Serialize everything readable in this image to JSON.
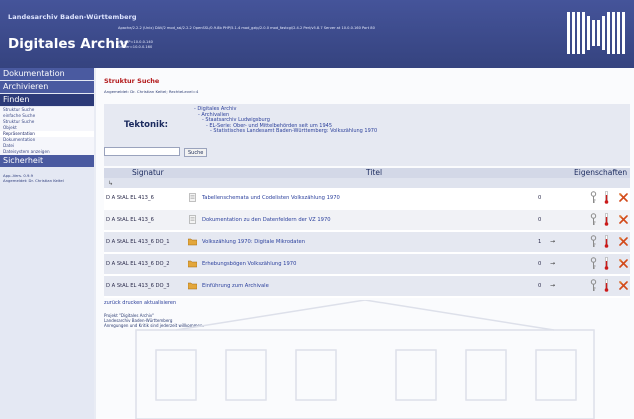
{
  "header": {
    "org": "Landesarchiv Baden-Württemberg",
    "app": "Digitales Archiv",
    "server_line": "Apache/2.2.2 (Unix) DAV/2 mod_ssl/2.2.2 OpenSSL/0.9.8b PHP/5.1.4 mod_gzip/2.0.0 mod_fastcgi/2.4.2 Perl/v5.8.7 Server at 10.0.0.160 Port 80",
    "version_lines": [
      "your IP=10.0.0.140",
      "Server=10.0.0.160"
    ]
  },
  "sidebar": {
    "sections": [
      {
        "label": "Dokumentation"
      },
      {
        "label": "Archivieren"
      },
      {
        "label": "Finden"
      },
      {
        "label": "Sicherheit"
      }
    ],
    "finden_items": [
      {
        "label": "Struktur Suche",
        "current": false
      },
      {
        "label": "einfache Suche",
        "current": false
      },
      {
        "label": "Struktur Suche",
        "current": false
      },
      {
        "label": "Objekt",
        "current": false
      },
      {
        "label": "Repräsentation",
        "current": true
      },
      {
        "label": "Dokumentation",
        "current": false
      },
      {
        "label": "Datei",
        "current": false
      },
      {
        "label": "Dateisystem anzeigen",
        "current": false
      }
    ],
    "app_version": "App.-Vers. 0.9.9",
    "logged_in": "Angemeldet: Dr. Christian Keitel"
  },
  "main": {
    "title": "Struktur Suche",
    "login": "Angemeldet: Dr. Christian Keitel; RechteLevel=4",
    "tektonik_label": "Tektonik:",
    "tree": [
      "- Digitales Archiv",
      "- Archivalien",
      "- Staatsarchiv Ludwigsburg",
      "- EL-Serie: Ober- und Mittelbehörden seit um 1945",
      "- Statistisches Landesamt Baden-Württemberg: Volkszählung 1970"
    ],
    "search_value": "",
    "search_button": "Suche",
    "columns": {
      "signatur": "Signatur",
      "titel": "Titel",
      "eigenschaften": "Eigenschaften"
    },
    "rows": [
      {
        "signatur": "D A StAL EL 413_6",
        "title": "Tabellenschemata und Codelisten Volkszählung 1970",
        "count": "0",
        "type": "doc",
        "arrow": false
      },
      {
        "signatur": "D A StAL EL 413_6",
        "title": "Dokumentation zu den Datenfeldern der VZ 1970",
        "count": "0",
        "type": "doc",
        "arrow": false
      },
      {
        "signatur": "D A StAL EL 413_6 DO_1",
        "title": "Volkszählung 1970: Digitale Mikrodaten",
        "count": "1",
        "type": "folder",
        "arrow": true
      },
      {
        "signatur": "D A StAL EL 413_6 DO_2",
        "title": "Erhebungsbögen Volkszählung 1970",
        "count": "0",
        "type": "folder",
        "arrow": true
      },
      {
        "signatur": "D A StAL EL 413_6 DO_3",
        "title": "Einführung zum Archivale",
        "count": "0",
        "type": "folder",
        "arrow": true
      }
    ],
    "footer_links": [
      "zurück",
      "drucken",
      "aktualisieren"
    ],
    "project_info": [
      "Projekt \"Digitales Archiv\"",
      "Landesarchiv Baden-Württemberg",
      "Anregungen und Kritik sind jederzeit willkommen."
    ]
  },
  "colors": {
    "header": "#3b4a8e",
    "nav_active": "#2c3a78",
    "title_red": "#b3191b",
    "link": "#2b3f9a"
  }
}
